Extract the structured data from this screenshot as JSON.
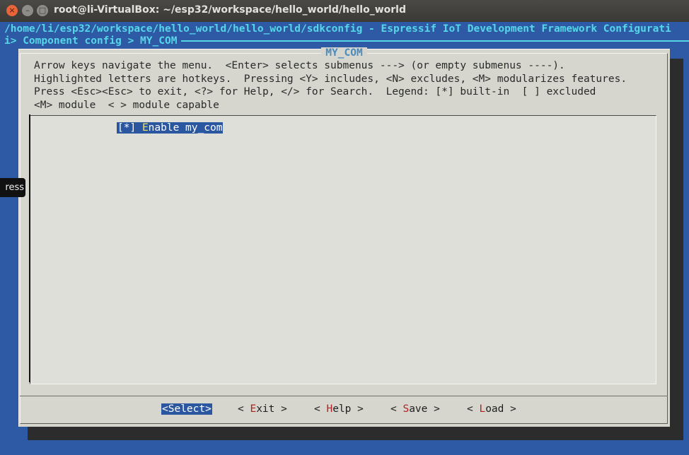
{
  "window": {
    "title": "root@li-VirtualBox: ~/esp32/workspace/hello_world/hello_world",
    "buttons": {
      "close": "×",
      "minimize": "–",
      "maximize": "□"
    }
  },
  "terminal": {
    "path_line": "/home/li/esp32/workspace/hello_world/hello_world/sdkconfig - Espressif IoT Development Framework Configurati",
    "breadcrumb": "i> Component config > MY_COM"
  },
  "dialog": {
    "title": "MY_COM",
    "help_lines": [
      "Arrow keys navigate the menu.  <Enter> selects submenus ---> (or empty submenus ----).",
      "Highlighted letters are hotkeys.  Pressing <Y> includes, <N> excludes, <M> modularizes features.",
      "Press <Esc><Esc> to exit, <?> for Help, </> for Search.  Legend: [*] built-in  [ ] excluded",
      "<M> module  < > module capable"
    ],
    "items": [
      {
        "state": "[*]",
        "hotkey": "E",
        "label_rest": "nable my_com",
        "selected": true
      }
    ],
    "buttons": [
      {
        "pre": "<",
        "hotkey": "S",
        "rest": "elect>",
        "selected": true
      },
      {
        "pre": "< ",
        "hotkey": "E",
        "rest": "xit >",
        "selected": false
      },
      {
        "pre": "< ",
        "hotkey": "H",
        "rest": "elp >",
        "selected": false
      },
      {
        "pre": "< ",
        "hotkey": "S",
        "rest": "ave >",
        "selected": false
      },
      {
        "pre": "< ",
        "hotkey": "L",
        "rest": "oad >",
        "selected": false
      }
    ]
  },
  "tooltip": {
    "text": "ress"
  },
  "colors": {
    "terminal_bg": "#2d59a5",
    "dialog_bg": "#d6d6cf",
    "accent": "#56d6e6",
    "selection": "#2b57a0"
  }
}
